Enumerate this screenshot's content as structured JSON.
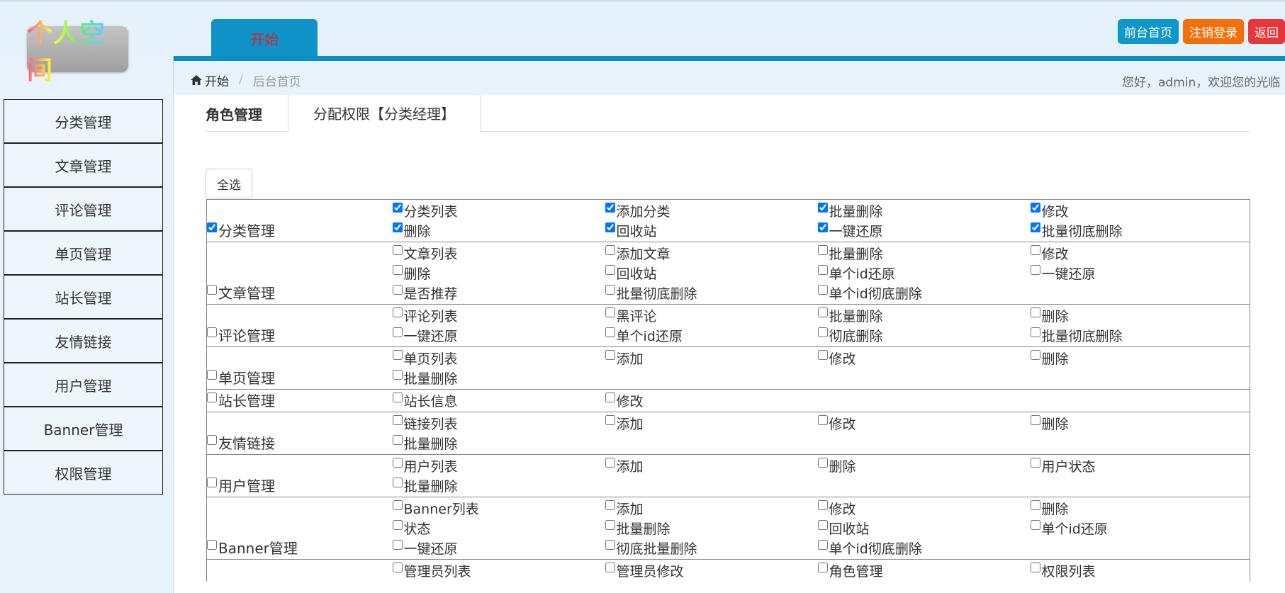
{
  "header": {
    "logo_text": "个人空间",
    "start_tab": "开始",
    "buttons": {
      "home": "前台首页",
      "logout": "注销登录",
      "back": "返回"
    }
  },
  "breadcrumb": {
    "home": "开始",
    "separator": "/",
    "current": "后台首页"
  },
  "welcome": "您好，admin，欢迎您的光临",
  "sidebar": [
    "分类管理",
    "文章管理",
    "评论管理",
    "单页管理",
    "站长管理",
    "友情链接",
    "用户管理",
    "Banner管理",
    "权限管理"
  ],
  "tabs": {
    "role_manage": "角色管理",
    "assign": "分配权限【分类经理】"
  },
  "select_all": "全选",
  "modules": [
    {
      "name": "分类管理",
      "checked": true,
      "perms": [
        {
          "label": "分类列表",
          "checked": true
        },
        {
          "label": "添加分类",
          "checked": true
        },
        {
          "label": "批量删除",
          "checked": true
        },
        {
          "label": "修改",
          "checked": true
        },
        {
          "label": "删除",
          "checked": true
        },
        {
          "label": "回收站",
          "checked": true
        },
        {
          "label": "一键还原",
          "checked": true
        },
        {
          "label": "批量彻底删除",
          "checked": true
        }
      ]
    },
    {
      "name": "文章管理",
      "checked": false,
      "perms": [
        {
          "label": "文章列表",
          "checked": false
        },
        {
          "label": "添加文章",
          "checked": false
        },
        {
          "label": "批量删除",
          "checked": false
        },
        {
          "label": "修改",
          "checked": false
        },
        {
          "label": "删除",
          "checked": false
        },
        {
          "label": "回收站",
          "checked": false
        },
        {
          "label": "单个id还原",
          "checked": false
        },
        {
          "label": "一键还原",
          "checked": false
        },
        {
          "label": "是否推荐",
          "checked": false
        },
        {
          "label": "批量彻底删除",
          "checked": false
        },
        {
          "label": "单个id彻底删除",
          "checked": false
        }
      ]
    },
    {
      "name": "评论管理",
      "checked": false,
      "perms": [
        {
          "label": "评论列表",
          "checked": false
        },
        {
          "label": "黑评论",
          "checked": false
        },
        {
          "label": "批量删除",
          "checked": false
        },
        {
          "label": "删除",
          "checked": false
        },
        {
          "label": "一键还原",
          "checked": false
        },
        {
          "label": "单个id还原",
          "checked": false
        },
        {
          "label": "彻底删除",
          "checked": false
        },
        {
          "label": "批量彻底删除",
          "checked": false
        }
      ]
    },
    {
      "name": "单页管理",
      "checked": false,
      "perms": [
        {
          "label": "单页列表",
          "checked": false
        },
        {
          "label": "添加",
          "checked": false
        },
        {
          "label": "修改",
          "checked": false
        },
        {
          "label": "删除",
          "checked": false
        },
        {
          "label": "批量删除",
          "checked": false
        }
      ]
    },
    {
      "name": "站长管理",
      "checked": false,
      "perms": [
        {
          "label": "站长信息",
          "checked": false
        },
        {
          "label": "修改",
          "checked": false
        }
      ]
    },
    {
      "name": "友情链接",
      "checked": false,
      "perms": [
        {
          "label": "链接列表",
          "checked": false
        },
        {
          "label": "添加",
          "checked": false
        },
        {
          "label": "修改",
          "checked": false
        },
        {
          "label": "删除",
          "checked": false
        },
        {
          "label": "批量删除",
          "checked": false
        }
      ]
    },
    {
      "name": "用户管理",
      "checked": false,
      "perms": [
        {
          "label": "用户列表",
          "checked": false
        },
        {
          "label": "添加",
          "checked": false
        },
        {
          "label": "删除",
          "checked": false
        },
        {
          "label": "用户状态",
          "checked": false
        },
        {
          "label": "批量删除",
          "checked": false
        }
      ]
    },
    {
      "name": "Banner管理",
      "checked": false,
      "perms": [
        {
          "label": "Banner列表",
          "checked": false
        },
        {
          "label": "添加",
          "checked": false
        },
        {
          "label": "修改",
          "checked": false
        },
        {
          "label": "删除",
          "checked": false
        },
        {
          "label": "状态",
          "checked": false
        },
        {
          "label": "批量删除",
          "checked": false
        },
        {
          "label": "回收站",
          "checked": false
        },
        {
          "label": "单个id还原",
          "checked": false
        },
        {
          "label": "一键还原",
          "checked": false
        },
        {
          "label": "彻底批量删除",
          "checked": false
        },
        {
          "label": "单个id彻底删除",
          "checked": false
        }
      ]
    },
    {
      "name": "",
      "checked": false,
      "perms": [
        {
          "label": "管理员列表",
          "checked": false
        },
        {
          "label": "管理员修改",
          "checked": false
        },
        {
          "label": "角色管理",
          "checked": false
        },
        {
          "label": "权限列表",
          "checked": false
        }
      ]
    }
  ]
}
